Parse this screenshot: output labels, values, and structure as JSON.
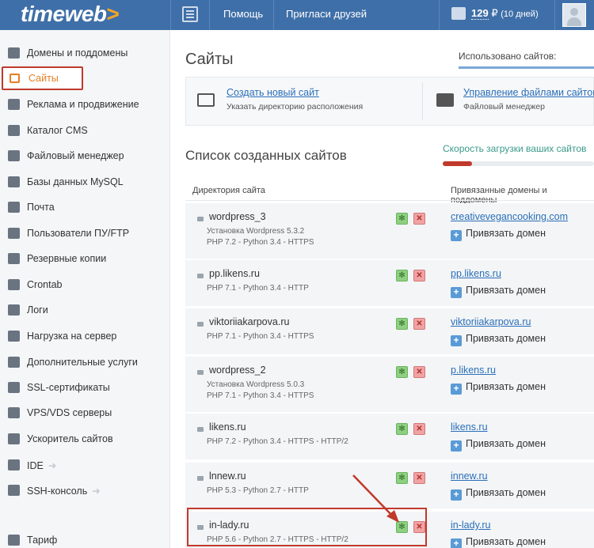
{
  "brand": {
    "logo_text": "timeweb",
    "logo_arrow": ">"
  },
  "topbar": {
    "help": "Помощь",
    "invite": "Пригласи друзей",
    "balance_amount": "129",
    "balance_currency": "₽",
    "balance_days": "(10 дней)"
  },
  "sidebar": {
    "items": [
      {
        "label": "Домены и поддомены",
        "icon": "sitemap-icon"
      },
      {
        "label": "Сайты",
        "icon": "site-icon",
        "active": true
      },
      {
        "label": "Реклама и продвижение",
        "icon": "ads-icon"
      },
      {
        "label": "Каталог CMS",
        "icon": "cms-icon"
      },
      {
        "label": "Файловый менеджер",
        "icon": "folder-icon"
      },
      {
        "label": "Базы данных MySQL",
        "icon": "database-icon"
      },
      {
        "label": "Почта",
        "icon": "mail-icon"
      },
      {
        "label": "Пользователи ПУ/FTP",
        "icon": "users-icon"
      },
      {
        "label": "Резервные копии",
        "icon": "backup-icon"
      },
      {
        "label": "Crontab",
        "icon": "clock-icon"
      },
      {
        "label": "Логи",
        "icon": "log-icon"
      },
      {
        "label": "Нагрузка на сервер",
        "icon": "chart-icon"
      },
      {
        "label": "Дополнительные услуги",
        "icon": "services-icon"
      },
      {
        "label": "SSL-сертификаты",
        "icon": "ssl-icon"
      },
      {
        "label": "VPS/VDS серверы",
        "icon": "server-icon"
      },
      {
        "label": "Ускоритель сайтов",
        "icon": "rocket-icon"
      },
      {
        "label": "IDE",
        "icon": "ide-icon",
        "external": "➜"
      },
      {
        "label": "SSH-консоль",
        "icon": "terminal-icon",
        "external": "➜"
      },
      {
        "label": "Тариф",
        "icon": "tariff-icon"
      }
    ]
  },
  "main": {
    "title": "Сайты",
    "usage_label": "Использовано сайтов:",
    "actions": [
      {
        "title": "Создать новый сайт",
        "subtitle": "Указать директорию расположения"
      },
      {
        "title": "Управление файлами сайтов",
        "subtitle": "Файловый менеджер"
      }
    ],
    "list_title": "Список созданных сайтов",
    "speed_link": "Скорость загрузки ваших сайтов",
    "columns": {
      "dir": "Директория сайта",
      "domains": "Привязанные домены и поддомены"
    },
    "bind_label": "Привязать домен",
    "sites": [
      {
        "name": "wordpress_3",
        "line1": "Установка Wordpress 5.3.2",
        "line2": "PHP 7.2 - Python 3.4 - HTTPS",
        "domain": "creativevegancooking.com"
      },
      {
        "name": "pp.likens.ru",
        "line1": "",
        "line2": "PHP 7.1 - Python 3.4 - HTTP",
        "domain": "pp.likens.ru"
      },
      {
        "name": "viktoriiakarpova.ru",
        "line1": "",
        "line2": "PHP 7.1 - Python 3.4 - HTTPS",
        "domain": "viktoriiakarpova.ru"
      },
      {
        "name": "wordpress_2",
        "line1": "Установка Wordpress 5.0.3",
        "line2": "PHP 7.1 - Python 3.4 - HTTPS",
        "domain": "p.likens.ru"
      },
      {
        "name": "likens.ru",
        "line1": "",
        "line2": "PHP 7.2 - Python 3.4 - HTTPS - HTTP/2",
        "domain": "likens.ru"
      },
      {
        "name": "lnnew.ru",
        "line1": "",
        "line2": "PHP 5.3 - Python 2.7 - HTTP",
        "domain": "innew.ru"
      },
      {
        "name": "in-lady.ru",
        "line1": "",
        "line2": "PHP 5.6 - Python 2.7 - HTTPS - HTTP/2",
        "domain": "in-lady.ru"
      }
    ]
  },
  "colors": {
    "topbar": "#3f6fa8",
    "accent": "#e67e22",
    "link": "#2a6fb8",
    "annotation": "#c0392b"
  }
}
